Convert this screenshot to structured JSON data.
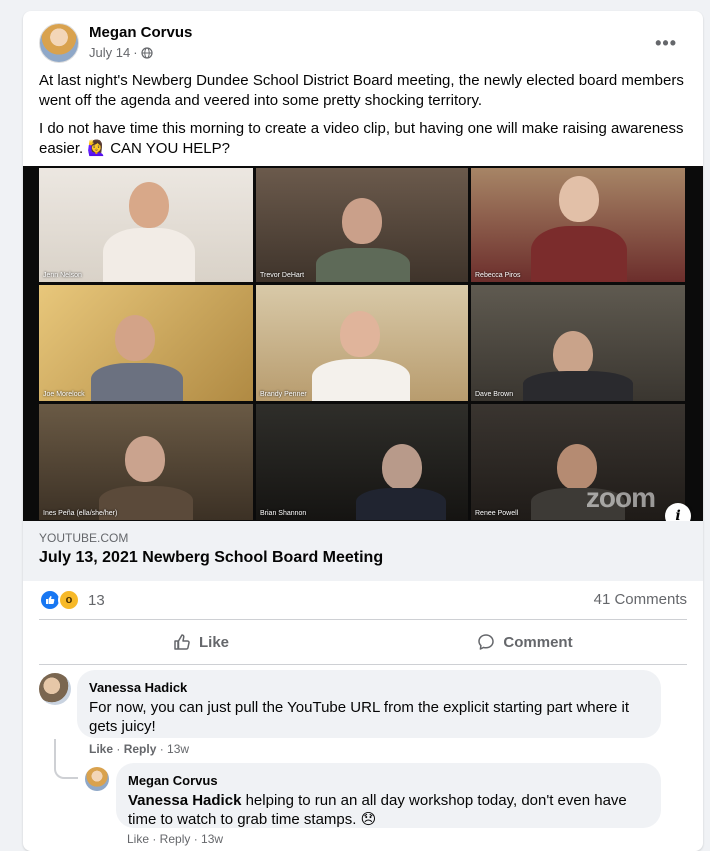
{
  "post": {
    "author": "Megan Corvus",
    "date": "July 14",
    "date_separator": "·",
    "paragraph1": "At last night's Newberg Dundee School District Board meeting, the newly elected board members went off the agenda and veered into some pretty shocking territory.",
    "paragraph2": "I do not have time this morning to create a video clip, but having one will make raising awareness easier.  🙋‍♀️ CAN YOU HELP?",
    "more_label": "•••"
  },
  "video": {
    "participants": [
      "Jenn Nelson",
      "Trevor DeHart",
      "Rebecca Piros",
      "Joe Morelock",
      "Brandy Penner",
      "Dave Brown",
      "Ines Peña (ella/she/her)",
      "Brian Shannon",
      "Renee Powell"
    ],
    "watermark": "zoom",
    "info_label": "i"
  },
  "link": {
    "domain": "YOUTUBE.COM",
    "title": "July 13, 2021 Newberg School Board Meeting"
  },
  "engagement": {
    "reaction_count": "13",
    "comments_count": "41 Comments"
  },
  "actions": {
    "like": "Like",
    "comment": "Comment"
  },
  "comments": [
    {
      "author": "Vanessa Hadick",
      "text": "For now, you can just pull the YouTube URL from the explicit starting part where it gets juicy!",
      "like": "Like",
      "reply": "Reply",
      "time": "13w"
    },
    {
      "author": "Megan Corvus",
      "mention": "Vanessa Hadick",
      "text": " helping to run an all day workshop today, don't even have time to watch to grab time stamps. 😞",
      "meta_partial": "Like · Reply · 13w"
    }
  ],
  "colors": {
    "accent": "#1877f2",
    "highlight_border": "#6ad54b",
    "background": "#f0f2f5"
  }
}
